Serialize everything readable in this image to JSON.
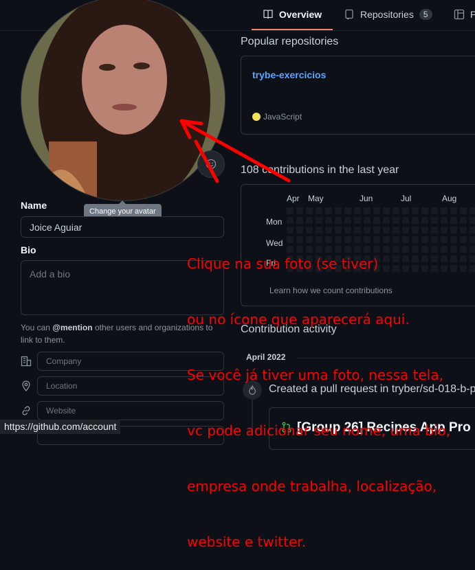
{
  "nav": {
    "tabs": [
      {
        "label": "Overview",
        "active": true
      },
      {
        "label": "Repositories",
        "count": "5"
      },
      {
        "label": "P"
      }
    ]
  },
  "avatar": {
    "tooltip": "Change your avatar"
  },
  "profile_form": {
    "name_label": "Name",
    "name_value": "Joice Aguiar",
    "bio_label": "Bio",
    "bio_placeholder": "Add a bio",
    "hint_prefix": "You can ",
    "hint_mention": "@mention",
    "hint_suffix": " other users and organizations to link to them.",
    "company_placeholder": "Company",
    "location_placeholder": "Location",
    "website_placeholder": "Website"
  },
  "popular": {
    "title": "Popular repositories",
    "repo_name": "trybe-exercicios",
    "language": "JavaScript",
    "language_color": "#f1e05a"
  },
  "contributions": {
    "title": "108 contributions in the last year",
    "months": [
      "Apr",
      "May",
      "Jun",
      "Jul",
      "Aug"
    ],
    "days": [
      "Mon",
      "Wed",
      "Fri"
    ],
    "learn_link": "Learn how we count contributions"
  },
  "activity": {
    "title": "Contribution activity",
    "period": "April 2022",
    "event": "Created a pull request in tryber/sd-018-b-p",
    "pr_title": "[Group 26] Recipes App Pro"
  },
  "annotation": {
    "lines": [
      "Clique na sua foto (se tiver)",
      "ou no ícone que aparecerá aqui.",
      "Se você já tiver uma foto, nessa tela,",
      "vc pode adicionar seu nome, uma bio,",
      "empresa onde trabalha, localização,",
      "website e twitter."
    ],
    "color": "#ff0000"
  },
  "statusbar": {
    "url": "https://github.com/account"
  }
}
